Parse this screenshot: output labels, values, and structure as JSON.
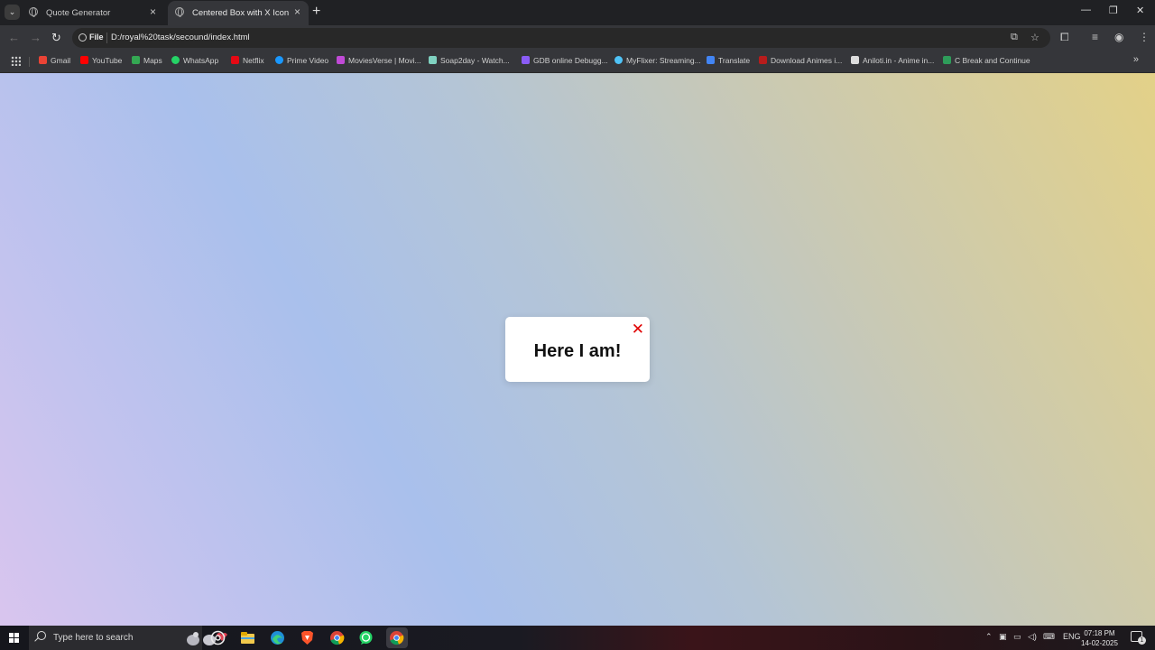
{
  "browser": {
    "tabs": [
      {
        "title": "Quote Generator"
      },
      {
        "title": "Centered Box with X Icon",
        "active": true
      }
    ],
    "toolbar": {
      "scheme_label": "File",
      "url": "D:/royal%20task/secound/index.html"
    },
    "bookmarks": [
      {
        "label": "Gmail",
        "color": "#ea4335"
      },
      {
        "label": "YouTube",
        "color": "#ff0000"
      },
      {
        "label": "Maps",
        "color": "#34a853"
      },
      {
        "label": "WhatsApp",
        "color": "#25d366"
      },
      {
        "label": "Netflix",
        "color": "#e50914"
      },
      {
        "label": "Prime Video",
        "color": "#1a98ff"
      },
      {
        "label": "MoviesVerse | Movi...",
        "color": "#c04ad6"
      },
      {
        "label": "Soap2day - Watch...",
        "color": "#7fd1c0"
      },
      {
        "label": "GDB online Debugg...",
        "color": "#8a5cf6"
      },
      {
        "label": "MyFlixer: Streaming...",
        "color": "#4fc3f7"
      },
      {
        "label": "Translate",
        "color": "#4285f4"
      },
      {
        "label": "Download Animes i...",
        "color": "#b71c1c"
      },
      {
        "label": "Aniloti.in - Anime in...",
        "color": "#dddddd"
      },
      {
        "label": "C Break and Continue",
        "color": "#2e9c5a"
      }
    ]
  },
  "page": {
    "box_text": "Here I am!",
    "close_glyph": "✕",
    "close_color": "#e00000"
  },
  "taskbar": {
    "search_placeholder": "Type here to search",
    "language": "ENG",
    "time": "07:18 PM",
    "date": "14-02-2025",
    "notification_count": "1"
  }
}
